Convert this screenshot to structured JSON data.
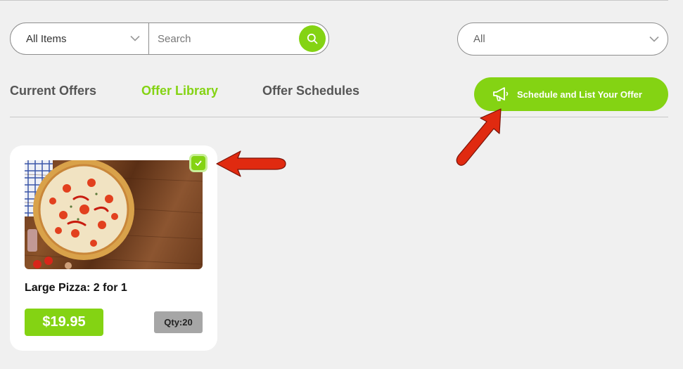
{
  "filters": {
    "category_value": "All Items",
    "search_placeholder": "Search",
    "location_value": "All"
  },
  "tabs": [
    {
      "label": "Current Offers",
      "active": false
    },
    {
      "label": "Offer Library",
      "active": true
    },
    {
      "label": "Offer Schedules",
      "active": false
    }
  ],
  "schedule_button": {
    "label": "Schedule and List Your Offer",
    "icon": "megaphone-icon"
  },
  "offers": [
    {
      "title": "Large Pizza: 2 for 1",
      "price": "$19.95",
      "qty": "Qty:20",
      "selected": true,
      "image": "pizza-image"
    }
  ],
  "colors": {
    "accent": "#84d313",
    "qty_badge": "#a6a6a6",
    "annotation_arrow": "#e02a10"
  }
}
